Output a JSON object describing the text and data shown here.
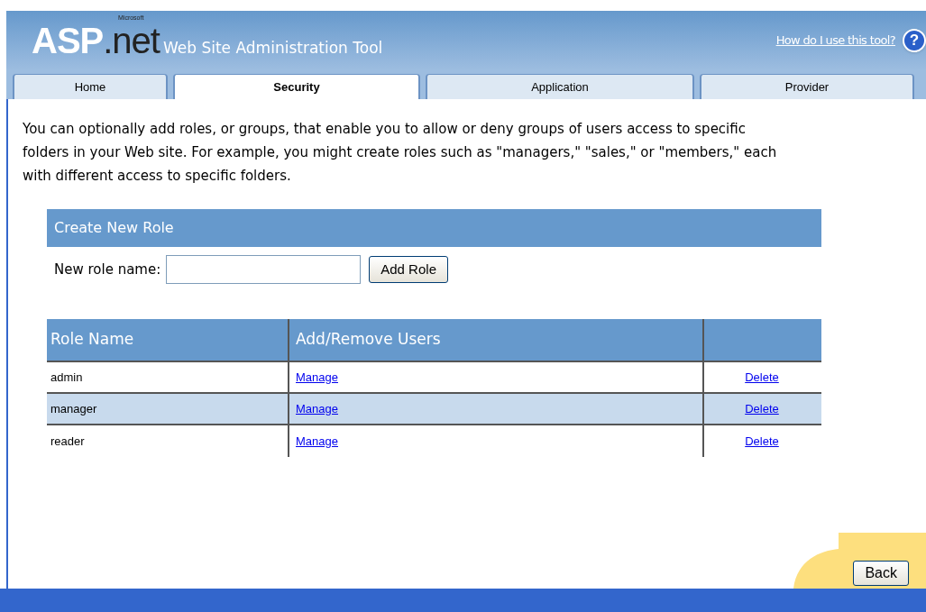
{
  "header": {
    "logo": {
      "brand": "ASP",
      "suffix": ".net",
      "maker": "Microsoft"
    },
    "title": "Web Site Administration Tool",
    "help_link": "How do I use this tool?",
    "help_icon": "?"
  },
  "tabs": [
    {
      "label": "Home",
      "selected": false
    },
    {
      "label": "Security",
      "selected": true
    },
    {
      "label": "Application",
      "selected": false
    },
    {
      "label": "Provider",
      "selected": false
    }
  ],
  "intro": "You can optionally add roles, or groups, that enable you to allow or deny groups of users access to specific folders in your Web site. For example, you might create roles such as \"managers,\" \"sales,\" or \"members,\" each with different access to specific folders.",
  "create_role": {
    "title": "Create New Role",
    "label": "New role name:",
    "button": "Add Role"
  },
  "table": {
    "columns": [
      "Role Name",
      "Add/Remove Users"
    ],
    "rows": [
      {
        "name": "admin",
        "manage": "Manage",
        "delete": "Delete",
        "highlighted": false
      },
      {
        "name": "manager",
        "manage": "Manage",
        "delete": "Delete",
        "highlighted": true
      },
      {
        "name": "reader",
        "manage": "Manage",
        "delete": "Delete",
        "highlighted": false
      }
    ]
  },
  "back_button": "Back"
}
